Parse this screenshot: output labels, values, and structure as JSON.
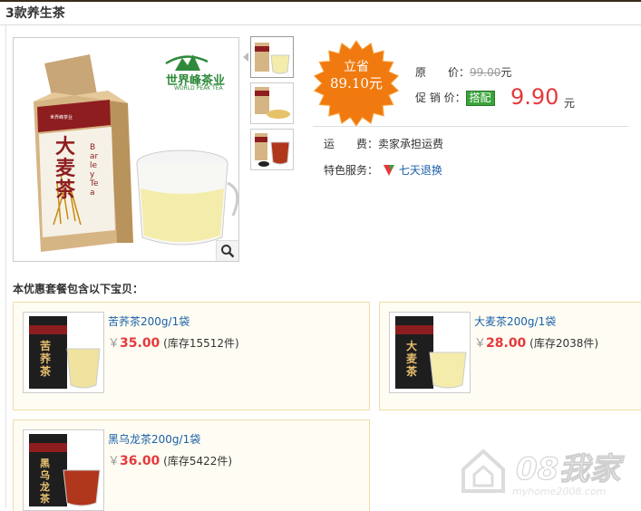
{
  "page_title": "3款养生茶",
  "product_image": {
    "brand_cn": "世界峰茶业",
    "brand_en": "WORLD PEAK TEA",
    "package_maker": "世界峰茶业",
    "package_title": "大麦茶",
    "package_en": "Barley Tea"
  },
  "promo_badge": {
    "line1": "立省",
    "line2": "89.10元"
  },
  "original_price": {
    "label": "原　　价：",
    "value": "99.00",
    "unit": "元"
  },
  "promo_price": {
    "label": "促 销 价：",
    "tag": "搭配",
    "value": "9.90",
    "unit": "元"
  },
  "shipping": {
    "label": "运　　费：",
    "value": "卖家承担运费"
  },
  "service": {
    "label": "特色服务：",
    "link": "七天退换"
  },
  "package_heading": "本优惠套餐包含以下宝贝：",
  "items": [
    {
      "name": "苦荞茶200g/1袋",
      "price": "35.00",
      "stock": "(库存15512件)",
      "pkg_text": "苦荞茶",
      "icon": "tea-package-image"
    },
    {
      "name": "大麦茶200g/1袋",
      "price": "28.00",
      "stock": "(库存2038件)",
      "pkg_text": "大麦茶",
      "icon": "tea-package-image"
    },
    {
      "name": "黑乌龙茶200g/1袋",
      "price": "36.00",
      "stock": "(库存5422件)",
      "pkg_text": "黑乌龙茶",
      "icon": "tea-package-image"
    }
  ],
  "currency_symbol": "￥",
  "watermark": {
    "main": "08我家",
    "sub": "myhome2008.com"
  },
  "colors": {
    "price_red": "#e4393c",
    "link_blue": "#1a5fa8",
    "tag_green": "#3aa33a",
    "badge_orange": "#f07a10",
    "card_bg": "#fffdf3"
  }
}
